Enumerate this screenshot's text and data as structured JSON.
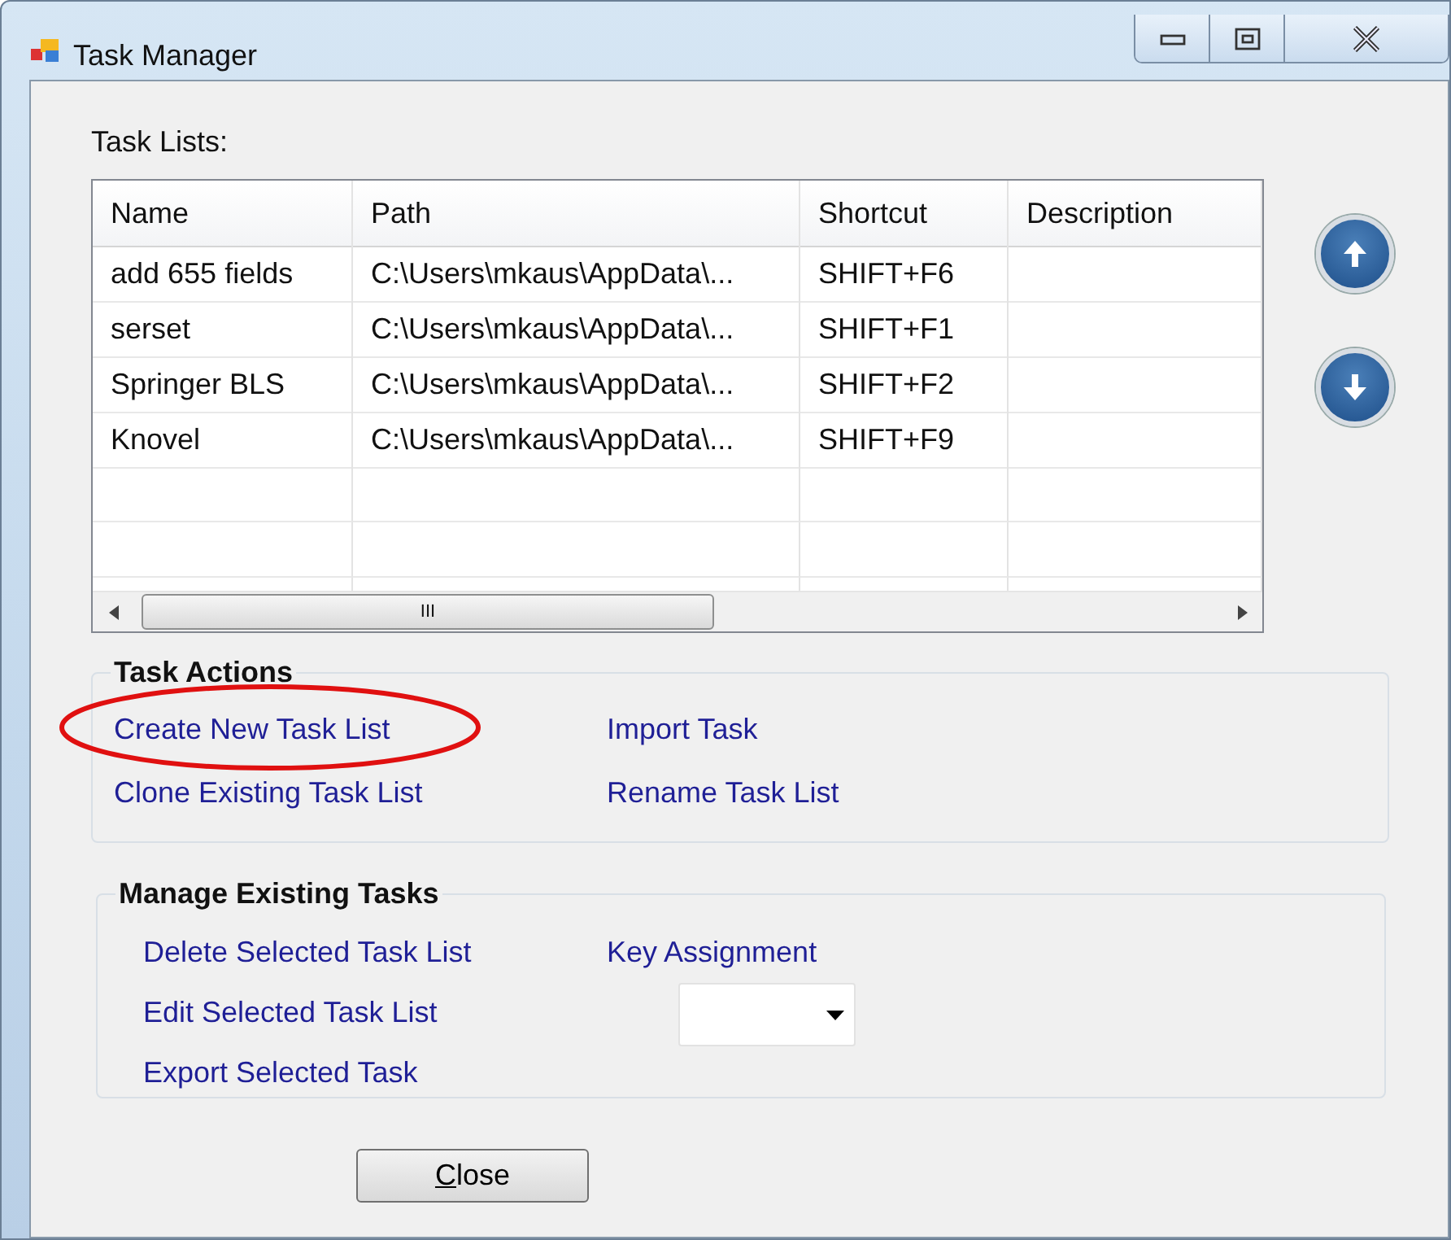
{
  "window": {
    "title": "Task Manager"
  },
  "task_lists": {
    "label": "Task Lists:",
    "columns": [
      "Name",
      "Path",
      "Shortcut",
      "Description"
    ],
    "rows": [
      {
        "name": "add 655 fields",
        "path": "C:\\Users\\mkaus\\AppData\\...",
        "shortcut": "SHIFT+F6"
      },
      {
        "name": "serset",
        "path": "C:\\Users\\mkaus\\AppData\\...",
        "shortcut": "SHIFT+F1"
      },
      {
        "name": "Springer BLS",
        "path": "C:\\Users\\mkaus\\AppData\\...",
        "shortcut": "SHIFT+F2"
      },
      {
        "name": "Knovel",
        "path": "C:\\Users\\mkaus\\AppData\\...",
        "shortcut": "SHIFT+F9"
      }
    ],
    "scrollbar_grip": "III"
  },
  "task_actions": {
    "title": "Task Actions",
    "links": [
      {
        "label": "Create New Task List",
        "circled": true
      },
      {
        "label": "Import Task",
        "circled": false
      },
      {
        "label": "Clone Existing Task List",
        "circled": false
      },
      {
        "label": "Rename Task List",
        "circled": false
      }
    ]
  },
  "manage_existing_tasks": {
    "title": "Manage Existing Tasks",
    "links": [
      "Delete Selected Task List",
      "Edit Selected Task List",
      "Export Selected Task"
    ],
    "key_assignment": {
      "label": "Key Assignment",
      "dropdown": {
        "kind": "combobox"
      }
    }
  },
  "close_button": {
    "label": "Close",
    "access_key_underlined": true
  }
}
